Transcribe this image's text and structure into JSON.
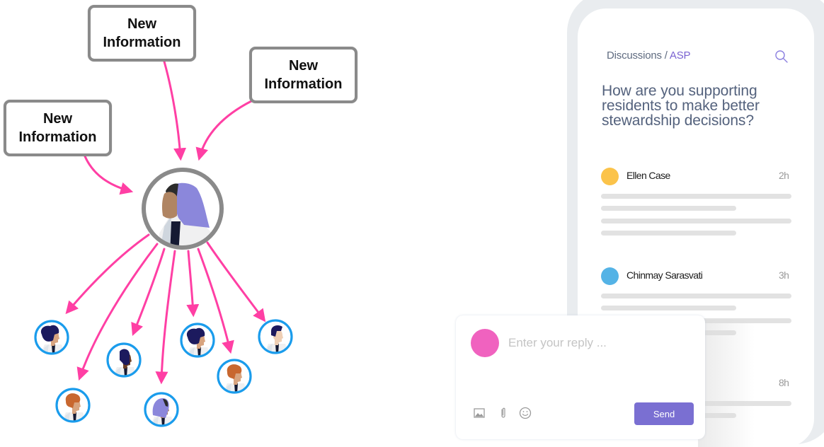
{
  "diagram": {
    "info_boxes": [
      {
        "line1": "New",
        "line2": "Information"
      },
      {
        "line1": "New",
        "line2": "Information"
      },
      {
        "line1": "New",
        "line2": "Information"
      }
    ],
    "central_person": {
      "icon": "woman-hijab-avatar",
      "ring_color": "#8a8a8a"
    },
    "recipients": [
      {
        "icon": "woman-curly-hair-avatar"
      },
      {
        "icon": "man-orange-hair-avatar"
      },
      {
        "icon": "man-beard-avatar"
      },
      {
        "icon": "woman-hijab-avatar"
      },
      {
        "icon": "woman-curly-hair-avatar"
      },
      {
        "icon": "man-orange-hair-avatar"
      },
      {
        "icon": "man-short-hair-avatar"
      }
    ],
    "colors": {
      "arrow": "#ff3fa4",
      "recipient_ring": "#1a9cec",
      "box_border": "#8a8a8a"
    }
  },
  "phone": {
    "breadcrumb": {
      "parent": "Discussions",
      "separator": " / ",
      "current": "ASP"
    },
    "search_icon": "search-icon",
    "question": "How are you supporting residents to make better stewardship decisions?",
    "posts": [
      {
        "author": "Ellen Case",
        "time": "2h",
        "avatar_color": "#fbc34a"
      },
      {
        "author": "Chinmay Sarasvati",
        "time": "3h",
        "avatar_color": "#54b3e6"
      },
      {
        "author": "",
        "time": "8h",
        "avatar_color": ""
      }
    ]
  },
  "reply": {
    "avatar_color": "#f062bf",
    "placeholder": "Enter your reply ...",
    "value": "",
    "tools": [
      "image-icon",
      "paperclip-icon",
      "emoji-icon"
    ],
    "send_label": "Send",
    "send_color": "#7a6fd2"
  }
}
